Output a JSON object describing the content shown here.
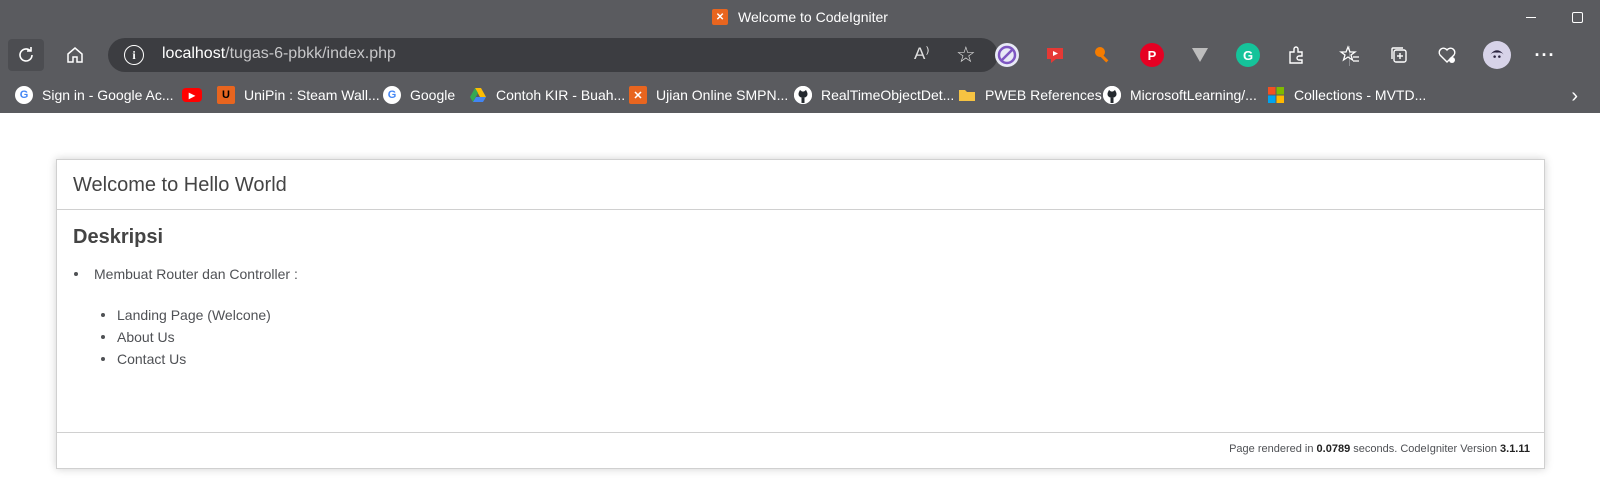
{
  "window": {
    "title": "Welcome to CodeIgniter"
  },
  "toolbar": {
    "url_host": "localhost",
    "url_path": "/tugas-6-pbkk/index.php",
    "info_icon_text": "i",
    "read_aloud_icon_text": "A⁾",
    "favorite_icon_text": "☆"
  },
  "extensions": [
    {
      "name": "ext-1-icon",
      "color": "#e8eaf6"
    },
    {
      "name": "ext-2-icon",
      "color": "#e53935"
    },
    {
      "name": "ext-3-icon",
      "color": "#f57c00"
    },
    {
      "name": "ext-4-icon",
      "color": "#e60023"
    },
    {
      "name": "ext-5-icon",
      "color": "#bdbdbd"
    },
    {
      "name": "grammarly-icon",
      "color": "#15c39a"
    }
  ],
  "bookmarks": [
    {
      "label": "Sign in - Google Ac...",
      "icon": "google-icon"
    },
    {
      "label": "",
      "icon": "youtube-icon"
    },
    {
      "label": "UniPin : Steam Wall...",
      "icon": "unipin-icon"
    },
    {
      "label": "Google",
      "icon": "google-icon"
    },
    {
      "label": "Contoh KIR - Buah...",
      "icon": "drive-icon"
    },
    {
      "label": "Ujian Online SMPN...",
      "icon": "xampp-icon"
    },
    {
      "label": "RealTimeObjectDet...",
      "icon": "github-icon"
    },
    {
      "label": "PWEB References",
      "icon": "folder-icon"
    },
    {
      "label": "MicrosoftLearning/...",
      "icon": "github-icon"
    },
    {
      "label": "Collections - MVTD...",
      "icon": "microsoft-icon"
    }
  ],
  "page": {
    "heading": "Welcome to Hello World",
    "section_title": "Deskripsi",
    "item_main": "Membuat Router dan Controller :",
    "sub_items": [
      "Landing Page (Welcone)",
      "About Us",
      "Contact Us"
    ],
    "footer_prefix": "Page rendered in ",
    "footer_time": "0.0789",
    "footer_mid": " seconds. CodeIgniter Version ",
    "footer_version": "3.1.11"
  }
}
